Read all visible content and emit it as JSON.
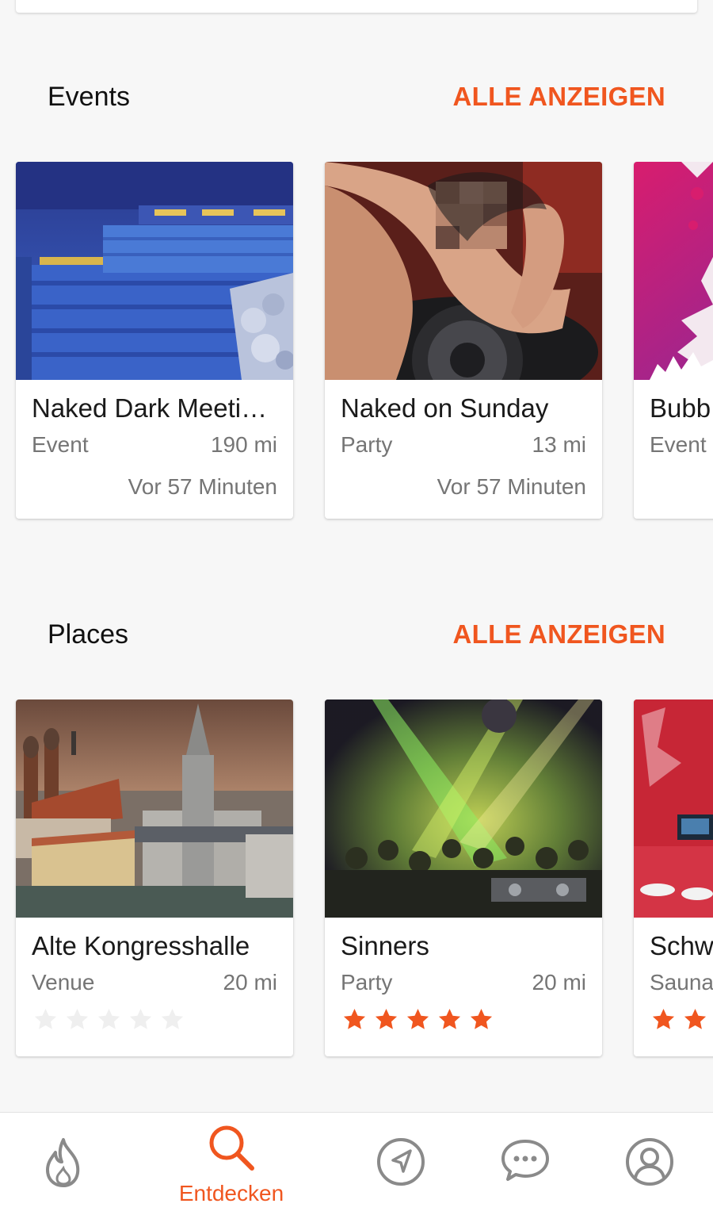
{
  "events": {
    "title": "Events",
    "see_all": "ALLE ANZEIGEN",
    "cards": [
      {
        "title": "Naked Dark Meeti…",
        "type": "Event",
        "distance": "190 mi",
        "time": "Vor 57 Minuten"
      },
      {
        "title": "Naked on Sunday",
        "type": "Party",
        "distance": "13 mi",
        "time": "Vor 57 Minuten"
      },
      {
        "title": "Bubb",
        "type": "Event"
      }
    ]
  },
  "places": {
    "title": "Places",
    "see_all": "ALLE ANZEIGEN",
    "cards": [
      {
        "title": "Alte Kongresshalle",
        "type": "Venue",
        "distance": "20 mi",
        "rating": 0
      },
      {
        "title": "Sinners",
        "type": "Party",
        "distance": "20 mi",
        "rating": 5
      },
      {
        "title": "Schw",
        "type": "Sauna",
        "rating": 2
      }
    ]
  },
  "bottom_nav": {
    "items": [
      {
        "icon": "flame-icon"
      },
      {
        "icon": "search-icon",
        "label": "Entdecken",
        "active": true
      },
      {
        "icon": "navigation-arrow-icon"
      },
      {
        "icon": "chat-bubble-icon"
      },
      {
        "icon": "profile-icon"
      }
    ]
  },
  "colors": {
    "accent": "#f0561f",
    "star_active": "#f0561f",
    "star_inactive": "#efefef",
    "nav_icon": "#8a8a8a"
  }
}
